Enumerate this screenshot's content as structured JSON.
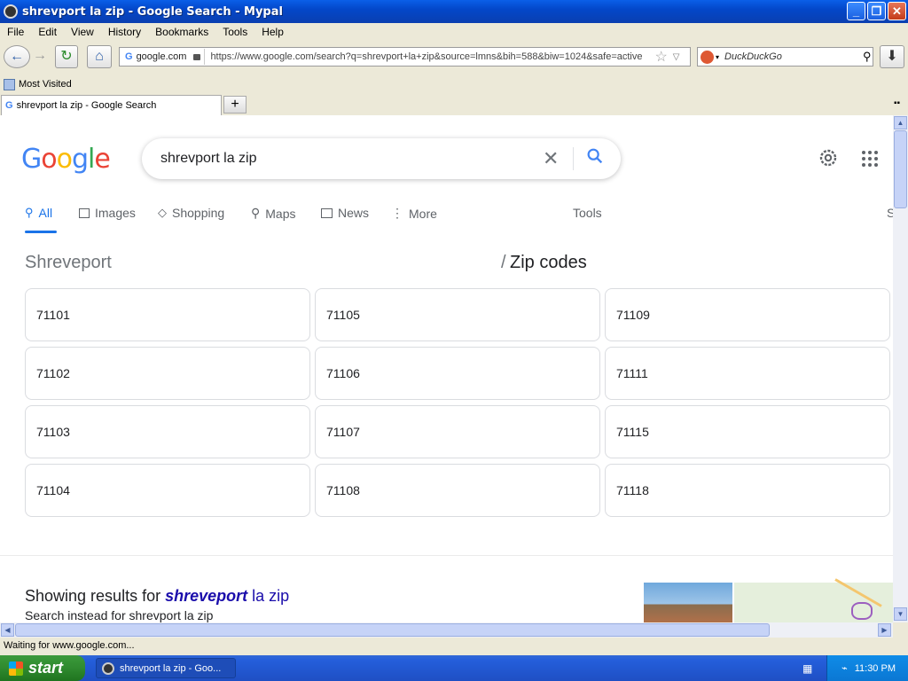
{
  "window": {
    "title": "shrevport la zip - Google Search - Mypal"
  },
  "menu": [
    "File",
    "Edit",
    "View",
    "History",
    "Bookmarks",
    "Tools",
    "Help"
  ],
  "nav": {
    "site_label": "google.com",
    "url": "https://www.google.com/search?q=shrevport+la+zip&source=lmns&bih=588&biw=1024&safe=active",
    "search_placeholder": "DuckDuckGo"
  },
  "bookmarks": {
    "most_visited": "Most Visited"
  },
  "tab": {
    "title": "shrevport la zip - Google Search"
  },
  "google": {
    "query": "shrevport la zip",
    "tabs": [
      "All",
      "Images",
      "Shopping",
      "Maps",
      "News",
      "More"
    ],
    "tools_label": "Tools",
    "right_partial": "S",
    "heading_left": "Shreveport",
    "heading_sep": "/",
    "heading_right": "Zip codes",
    "zip_codes": [
      "71101",
      "71105",
      "71109",
      "71102",
      "71106",
      "71111",
      "71103",
      "71107",
      "71115",
      "71104",
      "71108",
      "71118"
    ],
    "showing_prefix": "Showing results for ",
    "showing_bold": "shreveport",
    "showing_suffix": " la zip",
    "instead_text": "Search instead for shrevport la zip"
  },
  "status": {
    "text": "Waiting for www.google.com..."
  },
  "taskbar": {
    "start": "start",
    "item": "shrevport la zip - Goo...",
    "time": "11:30 PM"
  },
  "colors": {
    "accent": "#1a73e8",
    "link": "#1a0dab"
  }
}
